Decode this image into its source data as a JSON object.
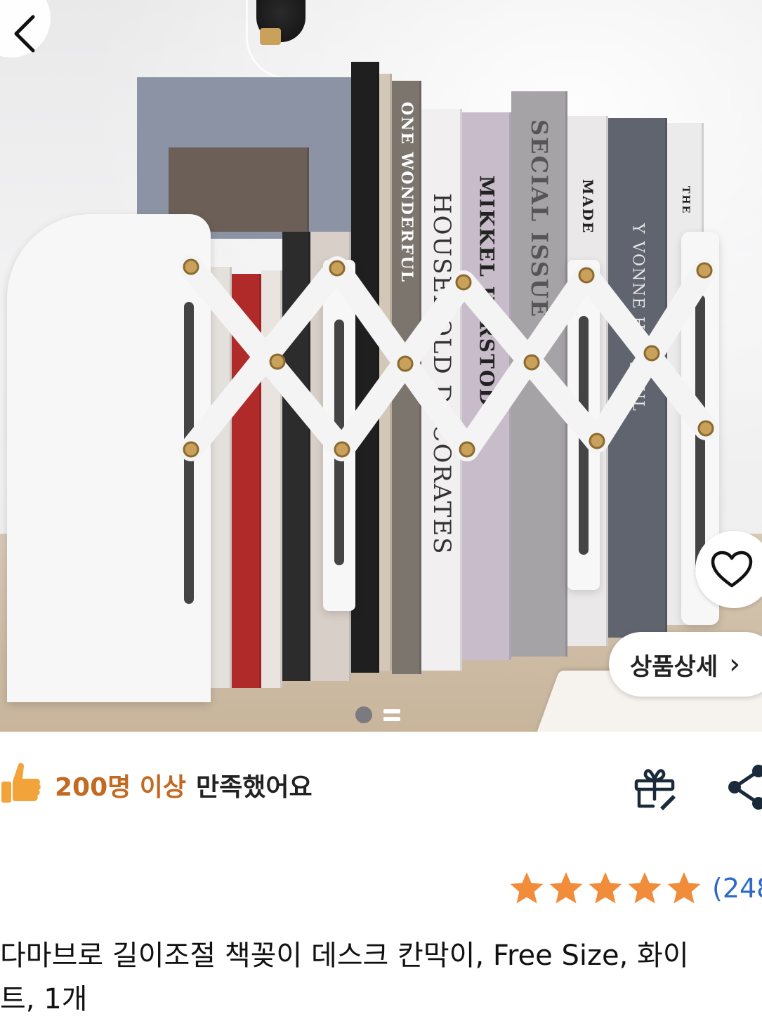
{
  "hero": {
    "book_spines": [
      "ONE WONDERFUL",
      "HOUSEHOLD DECORATES",
      "MIKKEL KARSTOD",
      "SECIAL ISSUE",
      "MADE",
      "Y VONNE HUS JUUL",
      "THE"
    ],
    "detail_button_label": "상품상세",
    "detail_chevron": "›",
    "page_count": 2,
    "page_current": 1
  },
  "satisfaction": {
    "count": "200명 이상",
    "text": "만족했어요"
  },
  "rating": {
    "stars": 5,
    "count_text": "(248"
  },
  "product": {
    "title_line1": "다마브로 길이조절 책꽂이 데스크 칸막이, Free Size, 화이",
    "title_line2": "트, 1개"
  },
  "colors": {
    "accent_orange": "#c36a22",
    "star_orange": "#f08c3a",
    "link_blue": "#2d6ac8"
  }
}
